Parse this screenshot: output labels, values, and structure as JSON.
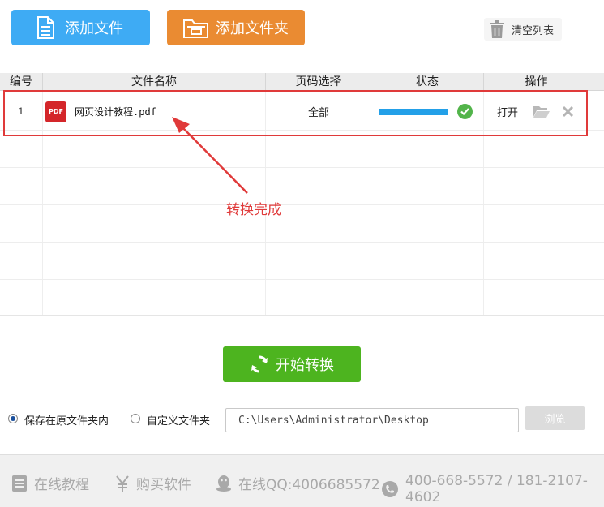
{
  "toolbar": {
    "add_file_label": "添加文件",
    "add_folder_label": "添加文件夹",
    "clear_list_label": "清空列表"
  },
  "table": {
    "headers": [
      "编号",
      "文件名称",
      "页码选择",
      "状态",
      "操作"
    ],
    "rows": [
      {
        "no": "1",
        "file_icon_text": "PDF",
        "file_name": "网页设计教程.pdf",
        "page_selection": "全部",
        "progress": 1.0,
        "status_icon": "check-circle-icon",
        "open_label": "打开",
        "folder_icon": "folder-open-icon",
        "remove_icon": "close-icon"
      }
    ]
  },
  "annotation": {
    "text": "转换完成",
    "color": "#e03a3a"
  },
  "start_button": {
    "label": "开始转换"
  },
  "output": {
    "option_original": "保存在原文件夹内",
    "option_custom": "自定义文件夹",
    "selected": "original",
    "path_value": "C:\\Users\\Administrator\\Desktop",
    "browse_label": "浏览"
  },
  "footer": {
    "tutorial": "在线教程",
    "buy": "购买软件",
    "qq": "在线QQ:4006685572",
    "phone": "400-668-5572 / 181-2107-4602"
  },
  "colors": {
    "add_file": "#3eabf4",
    "add_folder": "#ea8b32",
    "start": "#4db41f",
    "progress": "#23a0e8",
    "success": "#52b44a",
    "pdf": "#d4262a"
  }
}
